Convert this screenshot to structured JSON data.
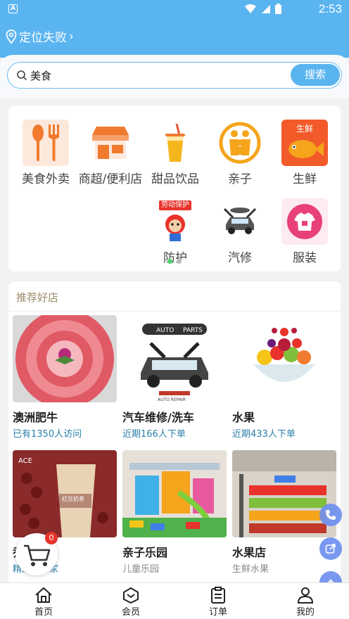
{
  "status": {
    "time": "2:53",
    "notif": "A"
  },
  "header": {
    "location": "定位失败"
  },
  "search": {
    "value": "美食",
    "button": "搜索"
  },
  "categories": [
    {
      "label": "美食外卖",
      "icon": "fork-spoon-icon"
    },
    {
      "label": "商超/便利店",
      "icon": "store-icon"
    },
    {
      "label": "甜品饮品",
      "icon": "drink-icon"
    },
    {
      "label": "亲子",
      "icon": "family-icon"
    },
    {
      "label": "生鲜",
      "icon": "fish-icon",
      "badge": "生鲜"
    },
    {
      "label": "防护",
      "icon": "mascot-icon",
      "badge": "劳动保护"
    },
    {
      "label": "汽修",
      "icon": "car-repair-icon"
    },
    {
      "label": "服装",
      "icon": "tshirt-icon"
    }
  ],
  "shops": {
    "title": "推荐好店",
    "items": [
      {
        "name": "澳洲肥牛",
        "sub": "已有1350人访问"
      },
      {
        "name": "汽车维修/洗车",
        "sub": "近期166人下单"
      },
      {
        "name": "水果",
        "sub": "近期433人下单"
      },
      {
        "name": "乔",
        "sub": "精选的商家"
      },
      {
        "name": "亲子乐园",
        "sub": "儿童乐园"
      },
      {
        "name": "水果店",
        "sub": "生鲜水果"
      }
    ],
    "logo_text": {
      "auto": "AUTO",
      "parts": "PARTS",
      "repair": "AUTO REPAIR",
      "tea": "红豆奶茶",
      "ace": "ACE"
    }
  },
  "cart": {
    "count": "0"
  },
  "nav": [
    {
      "label": "首页",
      "icon": "home-icon"
    },
    {
      "label": "会员",
      "icon": "member-icon"
    },
    {
      "label": "订单",
      "icon": "order-icon"
    },
    {
      "label": "我的",
      "icon": "user-icon"
    }
  ],
  "colors": {
    "primary": "#5ab4f0",
    "orange": "#f07b2e",
    "link": "#2a7fa8"
  }
}
